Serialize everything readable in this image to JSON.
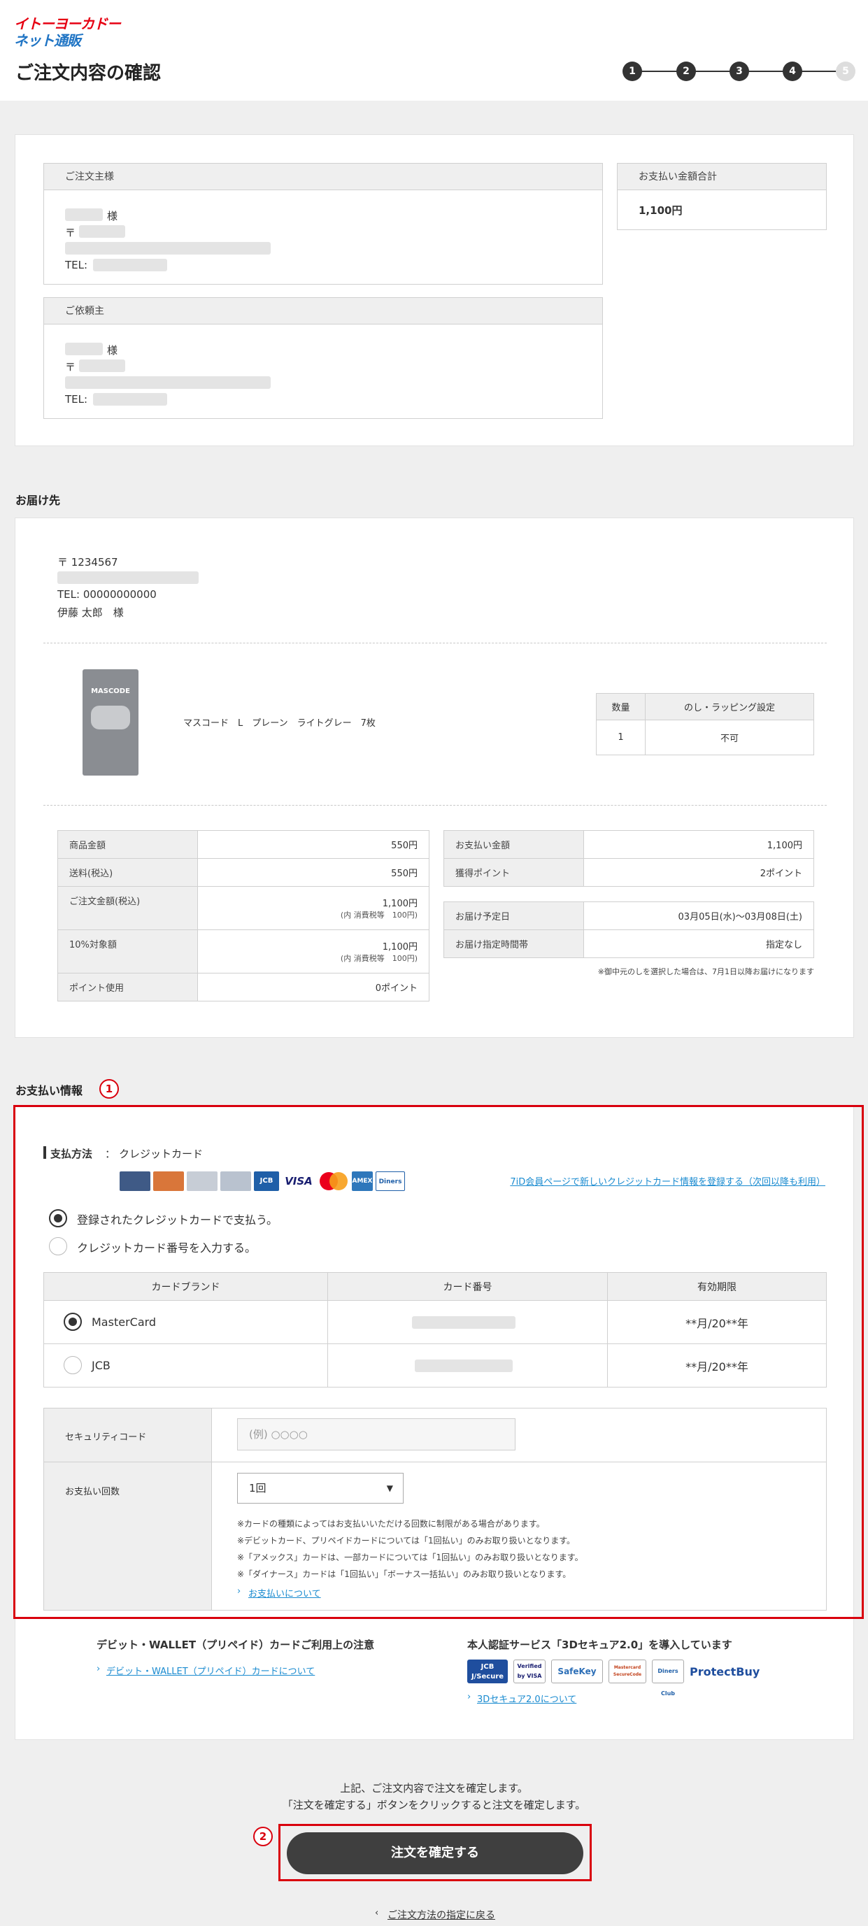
{
  "header": {
    "logo_line1": "イトーヨーカドー",
    "logo_line2": "ネット通販",
    "title": "ご注文内容の確認",
    "steps": [
      "1",
      "2",
      "3",
      "4",
      "5"
    ]
  },
  "orderer": {
    "heading": "ご注文主様",
    "suffix": "様",
    "postal_mark": "〒",
    "tel_label": "TEL:"
  },
  "requester": {
    "heading": "ご依頼主",
    "suffix": "様",
    "postal_mark": "〒",
    "tel_label": "TEL:"
  },
  "payment_total": {
    "heading": "お支払い金額合計",
    "value": "1,100円"
  },
  "delivery": {
    "section_title": "お届け先",
    "postal": "〒 1234567",
    "tel": "TEL: 00000000000",
    "name": "伊藤 太郎　様",
    "product_name": "マスコード　L　プレーン　ライトグレー　7枚",
    "product_image_text": "MASCODE",
    "qty_header": "数量",
    "wrap_header": "のし・ラッピング設定",
    "qty_value": "1",
    "wrap_value": "不可"
  },
  "summary_left": {
    "rows": [
      {
        "label": "商品金額",
        "value": "550円",
        "sub": ""
      },
      {
        "label": "送料(税込)",
        "value": "550円",
        "sub": ""
      },
      {
        "label": "ご注文金額(税込)",
        "value": "1,100円",
        "sub": "(内 消費税等　100円)"
      },
      {
        "label": "10%対象額",
        "value": "1,100円",
        "sub": "(内 消費税等　100円)"
      },
      {
        "label": "ポイント使用",
        "value": "0ポイント",
        "sub": ""
      }
    ]
  },
  "summary_right": {
    "rows1": [
      {
        "label": "お支払い金額",
        "value": "1,100円"
      },
      {
        "label": "獲得ポイント",
        "value": "2ポイント"
      }
    ],
    "rows2": [
      {
        "label": "お届け予定日",
        "value": "03月05日(水)～03月08日(土)"
      },
      {
        "label": "お届け指定時間帯",
        "value": "指定なし"
      }
    ],
    "note": "※御中元のしを選択した場合は、7月1日以降お届けになります"
  },
  "payment": {
    "section_title": "お支払い情報",
    "annotation1": "1",
    "method_label": "支払方法",
    "method_sep": "：",
    "method_value": "クレジットカード",
    "register_link": "7iD会員ページで新しいクレジットカード情報を登録する（次回以降も利用）",
    "card_logos": [
      "card",
      "card",
      "card",
      "card",
      "JCB",
      "VISA",
      "MC",
      "AMEX",
      "Diners"
    ],
    "option_registered": "登録されたクレジットカードで支払う。",
    "option_input": "クレジットカード番号を入力する。",
    "table_headers": [
      "カードブランド",
      "カード番号",
      "有効期限"
    ],
    "cards": [
      {
        "brand": "MasterCard",
        "expiry": "**月/20**年"
      },
      {
        "brand": "JCB",
        "expiry": "**月/20**年"
      }
    ],
    "security_label": "セキュリティコード",
    "security_placeholder": "(例) ○○○○",
    "installments_label": "お支払い回数",
    "installments_value": "1回",
    "installments_arrow": "▼",
    "notes": [
      "※カードの種類によってはお支払いいただける回数に制限がある場合があります。",
      "※デビットカード、プリペイドカードについては「1回払い」のみお取り扱いとなります。",
      "※「アメックス」カードは、一部カードについては「1回払い」のみお取り扱いとなります。",
      "※「ダイナース」カードは「1回払い」「ボーナス一括払い」のみお取り扱いとなります。"
    ],
    "about_link": "お支払いについて"
  },
  "debit": {
    "title": "デビット・WALLET（プリペイド）カードご利用上の注意",
    "link": "デビット・WALLET（プリペイド）カードについて"
  },
  "secure": {
    "title": "本人認証サービス「3Dセキュア2.0」を導入しています",
    "logos": [
      "JCB J/Secure",
      "Verified by VISA",
      "SafeKey",
      "Mastercard SecureCode",
      "Diners Club",
      "ProtectBuy"
    ],
    "link": "3Dセキュア2.0について"
  },
  "confirm": {
    "line1": "上記、ご注文内容で注文を確定します。",
    "line2": "「注文を確定する」ボタンをクリックすると注文を確定します。",
    "annotation2": "2",
    "button": "注文を確定する",
    "back_link": "ご注文方法の指定に戻る"
  },
  "colors": {
    "accent_red": "#d9000d",
    "button_dark": "#3f3f3f",
    "link_blue": "#1a8bd0"
  }
}
